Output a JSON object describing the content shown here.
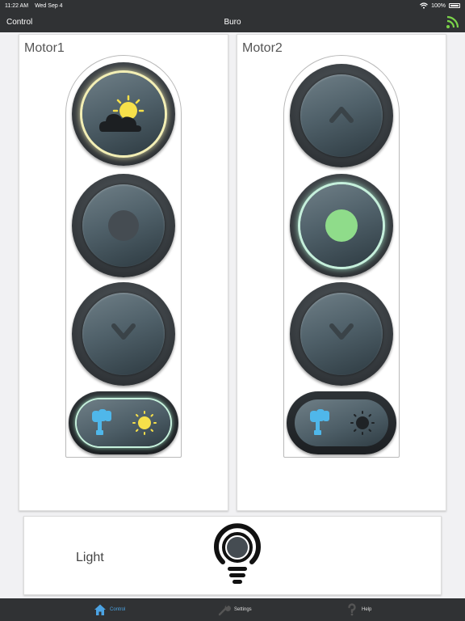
{
  "status_bar": {
    "time": "11:22 AM",
    "date": "Wed Sep 4",
    "battery": "100%"
  },
  "nav": {
    "back_label": "Control",
    "title": "Buro",
    "icon": "rss-icon"
  },
  "motors": [
    {
      "title": "Motor1",
      "top": "weather-icon",
      "middle_active": false,
      "bottom": "chevron-down-icon",
      "toggle_active": true
    },
    {
      "title": "Motor2",
      "top": "chevron-up-icon",
      "middle_active": true,
      "bottom": "chevron-down-icon",
      "toggle_active": false
    }
  ],
  "light": {
    "label": "Light",
    "icon": "lightbulb-icon"
  },
  "tabs": [
    {
      "label": "Control",
      "icon": "home-icon",
      "active": true
    },
    {
      "label": "Settings",
      "icon": "wrench-icon",
      "active": false
    },
    {
      "label": "Help",
      "icon": "question-icon",
      "active": false
    }
  ],
  "colors": {
    "accent": "#4ba3e3",
    "sun_yellow": "#f6e04a",
    "active_green": "#8fdc8a",
    "glow_yellow": "#f3efb5",
    "glow_green": "#c6f0dc",
    "bar_dark": "#303234"
  }
}
